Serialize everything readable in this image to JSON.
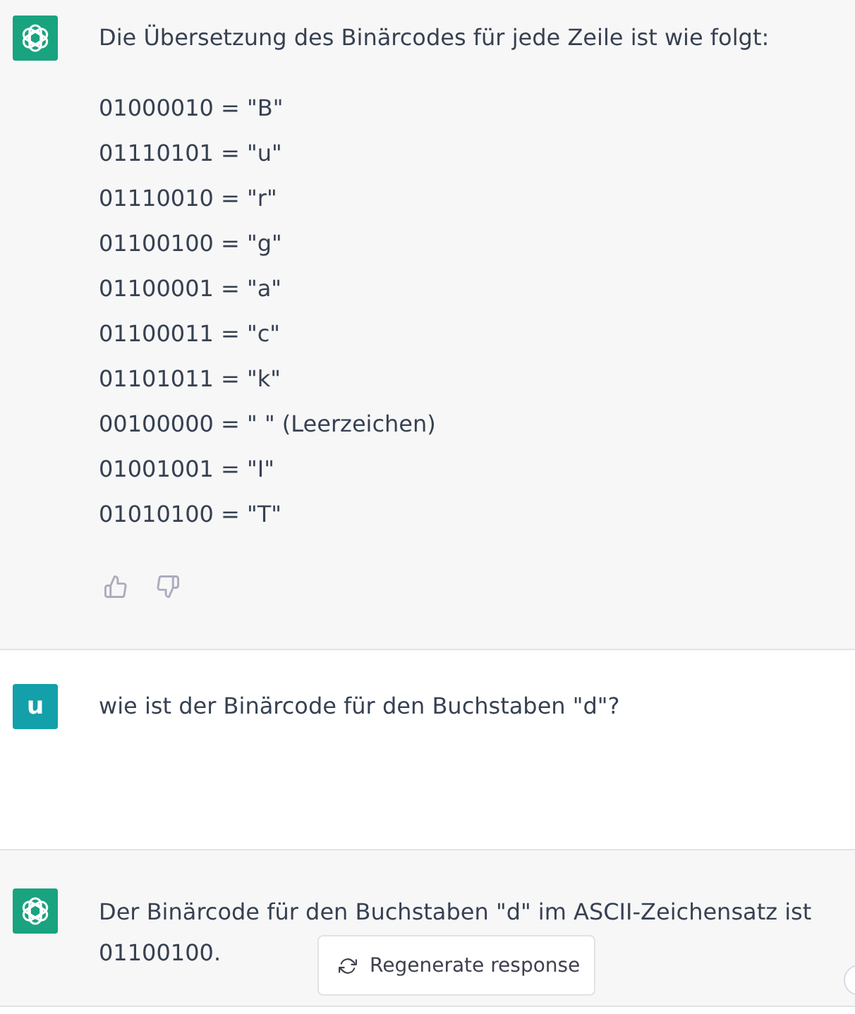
{
  "messages": [
    {
      "kind": "assistant",
      "text_lines": [
        "Die Übersetzung des Binärcodes für jede Zeile ist wie folgt:"
      ],
      "lines": [
        "01000010 = \"B\"",
        "01110101 = \"u\"",
        "01110010 = \"r\"",
        "01100100 = \"g\"",
        "01100001 = \"a\"",
        "01100011 = \"c\"",
        "01101011 = \"k\"",
        "00100000 = \" \" (Leerzeichen)",
        "01001001 = \"I\"",
        "01010100 = \"T\""
      ],
      "feedback_buttons": true
    },
    {
      "kind": "user",
      "avatar": "u",
      "text_lines": [
        "wie ist der Binärcode für den Buchstaben \"d\"?"
      ]
    },
    {
      "kind": "assistant",
      "text_lines": [
        "Der Binärcode für den Buchstaben \"d\" im ASCII-Zeichensatz ist",
        "01100100."
      ]
    }
  ],
  "regenerate_button": {
    "label": "Regenerate response"
  }
}
